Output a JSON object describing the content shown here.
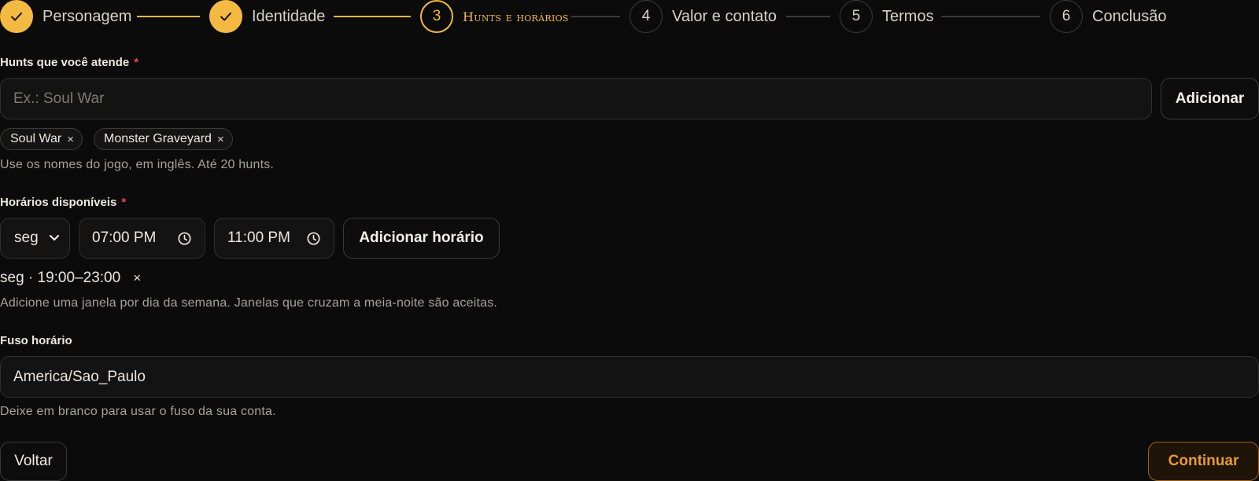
{
  "stepper": {
    "steps": [
      {
        "number": "1",
        "label": "Personagem",
        "state": "done"
      },
      {
        "number": "2",
        "label": "Identidade",
        "state": "done"
      },
      {
        "number": "3",
        "label": "Hunts e horários",
        "state": "active"
      },
      {
        "number": "4",
        "label": "Valor e contato",
        "state": "pending"
      },
      {
        "number": "5",
        "label": "Termos",
        "state": "pending"
      },
      {
        "number": "6",
        "label": "Conclusão",
        "state": "pending"
      }
    ]
  },
  "hunts": {
    "label": "Hunts que você atende",
    "required_mark": "*",
    "placeholder": "Ex.: Soul War",
    "add_label": "Adicionar",
    "chips": [
      {
        "label": "Soul War",
        "remove": "×"
      },
      {
        "label": "Monster Graveyard",
        "remove": "×"
      }
    ],
    "hint": "Use os nomes do jogo, em inglês. Até 20 hunts."
  },
  "schedule": {
    "label": "Horários disponíveis",
    "required_mark": "*",
    "day_value": "seg",
    "start_time": "07:00 PM",
    "end_time": "11:00 PM",
    "add_label": "Adicionar horário",
    "slots": [
      {
        "text": "seg · 19:00–23:00",
        "remove": "×"
      }
    ],
    "hint": "Adicione uma janela por dia da semana. Janelas que cruzam a meia-noite são aceitas."
  },
  "timezone": {
    "label": "Fuso horário",
    "value": "America/Sao_Paulo",
    "hint": "Deixe em branco para usar o fuso da sua conta."
  },
  "footer": {
    "back_label": "Voltar",
    "continue_label": "Continuar"
  },
  "colors": {
    "accent": "#f4b942",
    "required": "#e5484d",
    "continue_text": "#e79a36",
    "background": "#0b0b0b"
  },
  "icons": {
    "done_step": "check-icon",
    "time_input": "clock-icon",
    "select": "chevron-down-icon",
    "remove": "close-icon"
  }
}
